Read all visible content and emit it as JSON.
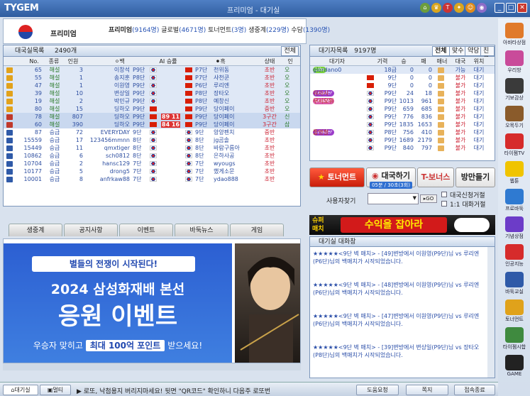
{
  "app": {
    "logo": "TYGEM",
    "title": "프리미엄 - 대기실"
  },
  "header": {
    "rank_name": "프리미엄",
    "stats": [
      {
        "label": "프리미엄",
        "count": "(9164명)"
      },
      {
        "label": "글로벌",
        "count": "(4671명)"
      },
      {
        "label": "토너먼트",
        "count": "(3명)"
      },
      {
        "label": "생중계",
        "count": "(229명)"
      },
      {
        "label": "수담",
        "count": "(1390명)"
      }
    ]
  },
  "rooms": {
    "title": "대국실목록",
    "count": "2490개",
    "all_label": "전체",
    "columns": [
      "No.",
      "종류",
      "인원",
      "백",
      "AI 승률",
      "흑",
      "상태",
      "인"
    ],
    "rows": [
      {
        "no": "65",
        "type": "해설",
        "ppl": "3",
        "white": "이창석",
        "wr": "P9단",
        "ai": "",
        "black": "천위동",
        "brank": "P7단",
        "state": "초반",
        "extra": "오"
      },
      {
        "no": "55",
        "type": "해설",
        "ppl": "1",
        "white": "송지훈",
        "wr": "P8단",
        "ai": "",
        "black": "샤천쿤",
        "brank": "P7단",
        "state": "초반",
        "extra": "오"
      },
      {
        "no": "47",
        "type": "해설",
        "ppl": "1",
        "white": "이원영",
        "wr": "P9단",
        "ai": "",
        "black": "루리엔",
        "brank": "P6단",
        "state": "초반",
        "extra": "오"
      },
      {
        "no": "39",
        "type": "해설",
        "ppl": "10",
        "white": "변상일",
        "wr": "P9단",
        "ai": "",
        "black": "장타오",
        "brank": "P8단",
        "state": "초반",
        "extra": "오"
      },
      {
        "no": "19",
        "type": "해설",
        "ppl": "2",
        "white": "박민규",
        "wr": "P9단",
        "ai": "",
        "black": "예창신",
        "brank": "P8단",
        "state": "초반",
        "extra": "오"
      },
      {
        "no": "80",
        "type": "해설",
        "ppl": "15",
        "white": "딩하오",
        "wr": "P9단",
        "ai": "",
        "black": "당이페이",
        "brank": "P9단",
        "state": "중반",
        "extra": "오"
      },
      {
        "no": "78",
        "type": "해설",
        "ppl": "807",
        "white": "딩하오",
        "wr": "P9단",
        "ai": "89 11",
        "black": "당이페이",
        "brank": "P9단",
        "state": "3구간",
        "extra": "신"
      },
      {
        "no": "60",
        "type": "해설",
        "ppl": "390",
        "white": "딩하오",
        "wr": "P9단",
        "ai": "84 16",
        "black": "당이페이",
        "brank": "P9단",
        "state": "3구간",
        "extra": "삼"
      },
      {
        "no": "87",
        "type": "승급",
        "ppl": "72",
        "white": "EVERYDAY",
        "wr": "9단",
        "ai": "",
        "black": "양양펜치",
        "brank": "9단",
        "state": "중반",
        "extra": ""
      },
      {
        "no": "15559",
        "type": "승급",
        "ppl": "17",
        "white": "123456mmnn",
        "wr": "8단",
        "ai": "",
        "black": "jg곰솔",
        "brank": "8단",
        "state": "초반",
        "extra": ""
      },
      {
        "no": "15449",
        "type": "승급",
        "ppl": "11",
        "white": "qmxtiger",
        "wr": "8단",
        "ai": "",
        "black": "바람구름아",
        "brank": "8단",
        "state": "초반",
        "extra": ""
      },
      {
        "no": "10862",
        "type": "승급",
        "ppl": "6",
        "white": "sch0812",
        "wr": "8단",
        "ai": "",
        "black": "은하사공",
        "brank": "8단",
        "state": "초반",
        "extra": ""
      },
      {
        "no": "10704",
        "type": "승급",
        "ppl": "2",
        "white": "hansc129",
        "wr": "7단",
        "ai": "",
        "black": "wyougs",
        "brank": "7단",
        "state": "초반",
        "extra": ""
      },
      {
        "no": "10177",
        "type": "승급",
        "ppl": "5",
        "white": "drong5",
        "wr": "7단",
        "ai": "",
        "black": "했게소문",
        "brank": "7단",
        "state": "초반",
        "extra": ""
      },
      {
        "no": "10001",
        "type": "승급",
        "ppl": "8",
        "white": "anfrkaw88",
        "wr": "7단",
        "ai": "",
        "black": "ydao888",
        "brank": "7단",
        "state": "초반",
        "extra": ""
      }
    ]
  },
  "news_tabs": [
    "생중계",
    "공지사항",
    "이벤트",
    "바둑뉴스",
    "게임"
  ],
  "banner": {
    "line1": "별들의 전쟁이 시작된다!",
    "line2": "2024 삼성화재배 본선",
    "line3": "응원 이벤트",
    "line4_pre": "우승자 맞히고",
    "line4_hl": "최대 100억 포인트",
    "line4_post": "받으세요!"
  },
  "users": {
    "title": "대기자목록",
    "count": "9197명",
    "tabs": [
      "전체",
      "맞수",
      "약당",
      "친구"
    ],
    "columns": [
      "대기자",
      "기력",
      "승",
      "패",
      "매너",
      "대국",
      "위치"
    ],
    "rows": [
      {
        "name": "giordano0",
        "badge": "Lite",
        "level": "18급",
        "win": "0",
        "loss": "0",
        "state": "가능",
        "loc": "대기"
      },
      {
        "name": "CHhelp99",
        "badge": "",
        "level": "9단",
        "win": "0",
        "loss": "0",
        "state": "불가",
        "loc": "대기"
      },
      {
        "name": "CHhelp133",
        "badge": "",
        "level": "9단",
        "win": "0",
        "loss": "0",
        "state": "불가",
        "loc": "대기"
      },
      {
        "name": "워자시",
        "badge": "Leader",
        "level": "P9단",
        "win": "24",
        "loss": "18",
        "state": "불가",
        "loc": "대기"
      },
      {
        "name": "무시오위",
        "badge": "Leader",
        "level": "P9단",
        "win": "1013",
        "loss": "961",
        "state": "불가",
        "loc": "대기"
      },
      {
        "name": "한우진",
        "badge": "",
        "level": "P9단",
        "win": "659",
        "loss": "685",
        "state": "불가",
        "loc": "대기"
      },
      {
        "name": "설현준",
        "badge": "",
        "level": "P9단",
        "win": "776",
        "loss": "836",
        "state": "불가",
        "loc": "대기"
      },
      {
        "name": "박영훈",
        "badge": "",
        "level": "P9단",
        "win": "1835",
        "loss": "1653",
        "state": "불가",
        "loc": "대기"
      },
      {
        "name": "툴명철",
        "badge": "Leader",
        "level": "P8단",
        "win": "756",
        "loss": "410",
        "state": "불가",
        "loc": "대기"
      },
      {
        "name": "문민종",
        "badge": "",
        "level": "P9단",
        "win": "1689",
        "loss": "2179",
        "state": "불가",
        "loc": "대기"
      },
      {
        "name": "송규상",
        "badge": "",
        "level": "P9단",
        "win": "840",
        "loss": "797",
        "state": "불가",
        "loc": "대기"
      }
    ]
  },
  "actions": {
    "tournament": "토너먼트",
    "match": "대국하기",
    "match_sub": "05분 / 30초(3회)",
    "bonus": "T-보너스",
    "make_room": "방만들기",
    "search_label": "사용자찾기",
    "go": "GO",
    "opt1": "대국신청거절",
    "opt2": "1:1 대화거절"
  },
  "promo": {
    "tag1": "슈퍼",
    "tag2": "매치",
    "text": "수익을 잡아라"
  },
  "chat": {
    "title": "대기실 대화창",
    "messages": [
      "★★★★★<9단 벽 매치> - [49]변방에서 이원영(P9단)님 vs 루리엔(P6단)님의 백매치가 시작되었습니다.",
      "★★★★★<9단 벽 매치> - [48]변방에서 이원영(P9단)님 vs 루리엔(P6단)님의 백매치가 시작되었습니다.",
      "★★★★★<9단 벽 매치> - [47]변방에서 이원영(P9단)님 vs 루리엔(P6단)님의 백매치가 시작되었습니다.",
      "★★★★★<9단 벽 매치> - [39]변방에서 변상일(P9단)님 vs 장타오(P8단)님의 백매치가 시작되었습니다."
    ]
  },
  "dock": [
    "아바타상점",
    "우리방",
    "기보감상",
    "오목두기",
    "타이젬TV",
    "웹툰",
    "프로바둑",
    "기념상점",
    "인공지능",
    "바둑교실",
    "토너먼트",
    "타이젬시합",
    "GAME"
  ],
  "status": {
    "tab1": "대기실",
    "tab2": "멀티",
    "ticker": "▶ 로또, 낙첨용지 버리지마세요! 뒷면 \"QR코드\" 확인하니 다음주 로또번",
    "help": "도움요청",
    "note": "쪽지",
    "exit": "접속종료"
  }
}
